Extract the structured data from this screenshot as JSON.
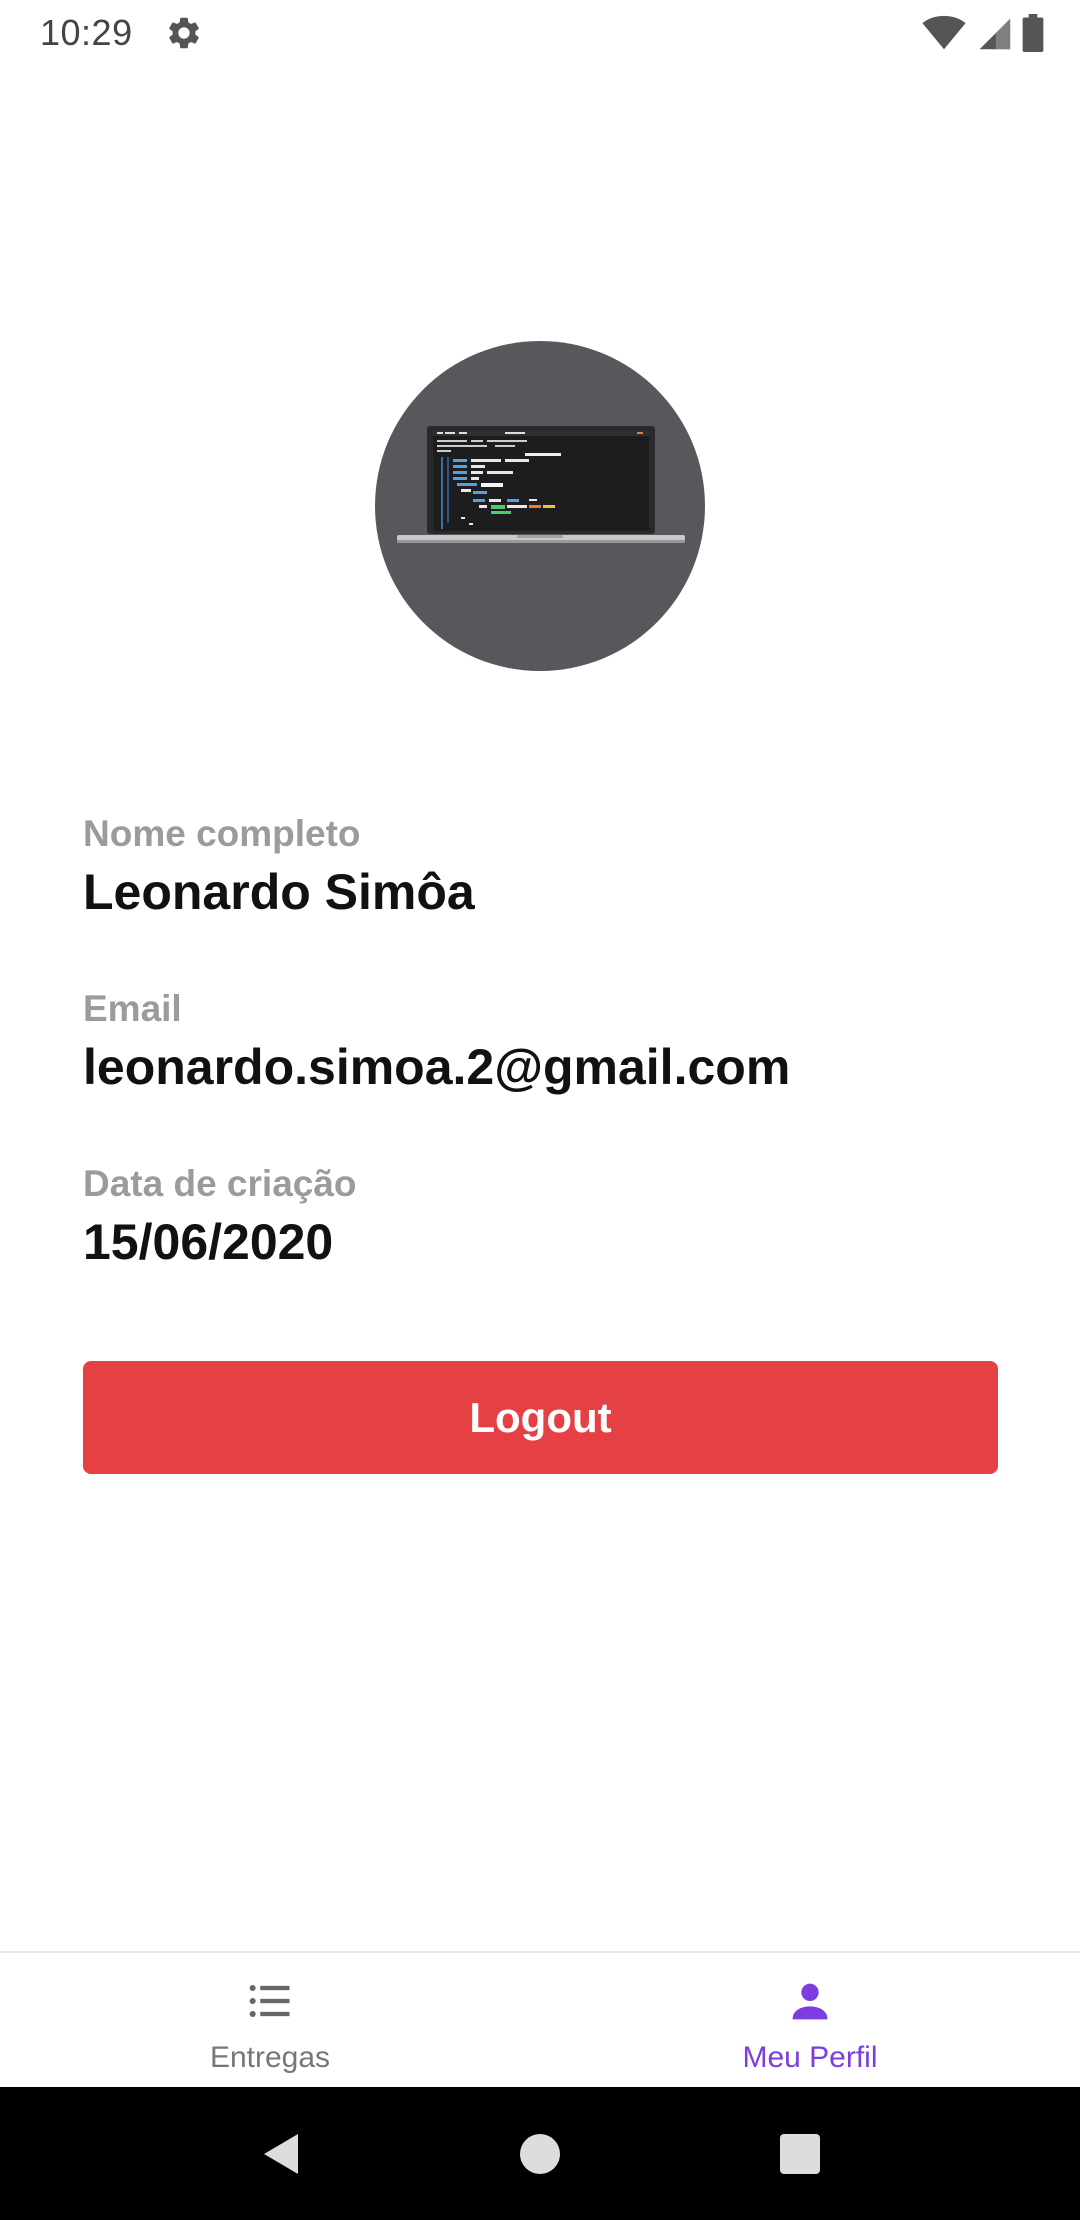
{
  "status_bar": {
    "time": "10:29",
    "icons": [
      "settings-gear-icon",
      "wifi-icon",
      "cell-signal-icon",
      "battery-icon"
    ]
  },
  "profile": {
    "avatar_icon": "laptop-code-avatar",
    "fields": [
      {
        "label": "Nome completo",
        "value": "Leonardo Simôa"
      },
      {
        "label": "Email",
        "value": "leonardo.simoa.2@gmail.com"
      },
      {
        "label": "Data de criação",
        "value": "15/06/2020"
      }
    ],
    "logout_label": "Logout"
  },
  "bottom_nav": {
    "items": [
      {
        "label": "Entregas",
        "icon": "list-icon",
        "active": false
      },
      {
        "label": "Meu Perfil",
        "icon": "person-icon",
        "active": true
      }
    ]
  },
  "system_nav": {
    "buttons": [
      "back-icon",
      "home-icon",
      "recents-icon"
    ]
  },
  "colors": {
    "accent": "#7d3de0",
    "logout": "#e54043",
    "label": "#9b9b9b",
    "avatar_bg": "#58575c"
  }
}
